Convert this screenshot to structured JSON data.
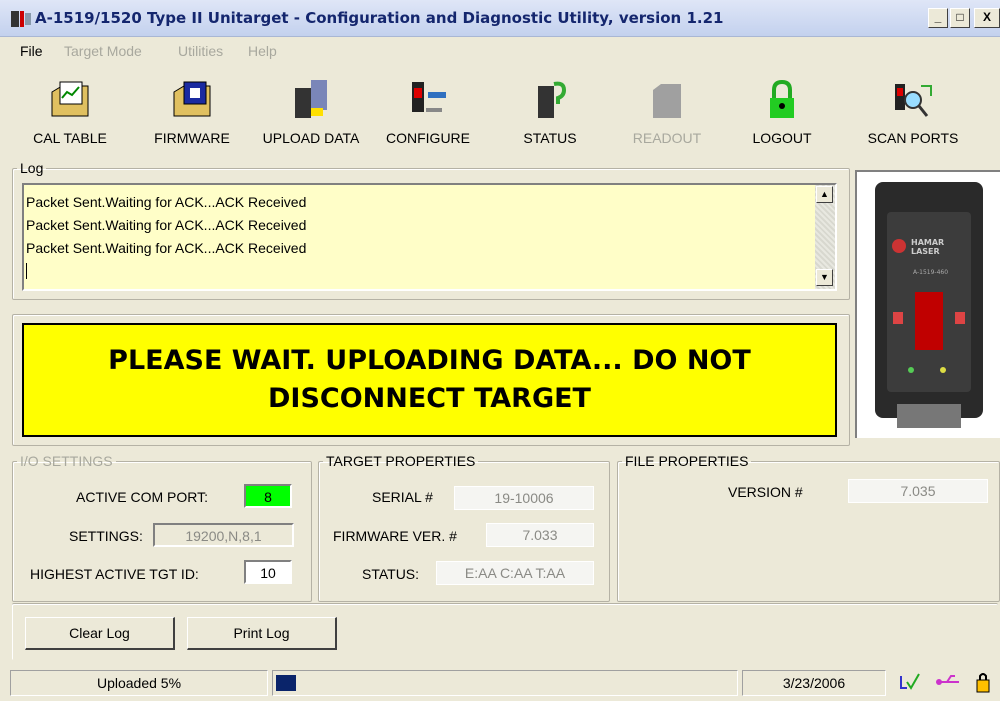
{
  "window": {
    "title": "A-1519/1520 Type II  Unitarget - Configuration and Diagnostic Utility, version 1.21",
    "min": "_",
    "max": "□",
    "close": "X"
  },
  "menu": [
    "File",
    "Target Mode",
    "Utilities",
    "Help"
  ],
  "toolbar": [
    "CAL TABLE",
    "FIRMWARE",
    "UPLOAD DATA",
    "CONFIGURE",
    "STATUS",
    "READOUT",
    "LOGOUT",
    "SCAN PORTS"
  ],
  "log": {
    "legend": "Log",
    "lines": [
      "Packet Sent.Waiting for ACK...ACK Received",
      "Packet Sent.Waiting for ACK...ACK Received",
      "Packet Sent.Waiting for ACK...ACK Received"
    ]
  },
  "banner": {
    "line1": "PLEASE WAIT. UPLOADING DATA... DO NOT",
    "line2": "DISCONNECT TARGET"
  },
  "device": {
    "brand1": "HAMAR",
    "brand2": "LASER",
    "model": "A-1519-460"
  },
  "io": {
    "legend": "I/O SETTINGS",
    "port_label": "ACTIVE COM PORT:",
    "port_value": "8",
    "settings_label": "SETTINGS:",
    "settings_value": "19200,N,8,1",
    "tgt_label": "HIGHEST ACTIVE TGT ID:",
    "tgt_value": "10"
  },
  "target": {
    "legend": "TARGET PROPERTIES",
    "serial_label": "SERIAL #",
    "serial_value": "19-10006",
    "fw_label": "FIRMWARE VER. #",
    "fw_value": "7.033",
    "status_label": "STATUS:",
    "status_value": "E:AA C:AA T:AA"
  },
  "file": {
    "legend": "FILE PROPERTIES",
    "version_label": "VERSION #",
    "version_value": "7.035"
  },
  "buttons": {
    "clear": "Clear Log",
    "print": "Print Log"
  },
  "status": {
    "text": "Uploaded 5%",
    "progress_fraction": 0.05,
    "date": "3/23/2006"
  },
  "colors": {
    "banner": "#ffff00",
    "log_bg": "#fffec8",
    "port_ok": "#00ff00",
    "progress": "#0a246a"
  }
}
